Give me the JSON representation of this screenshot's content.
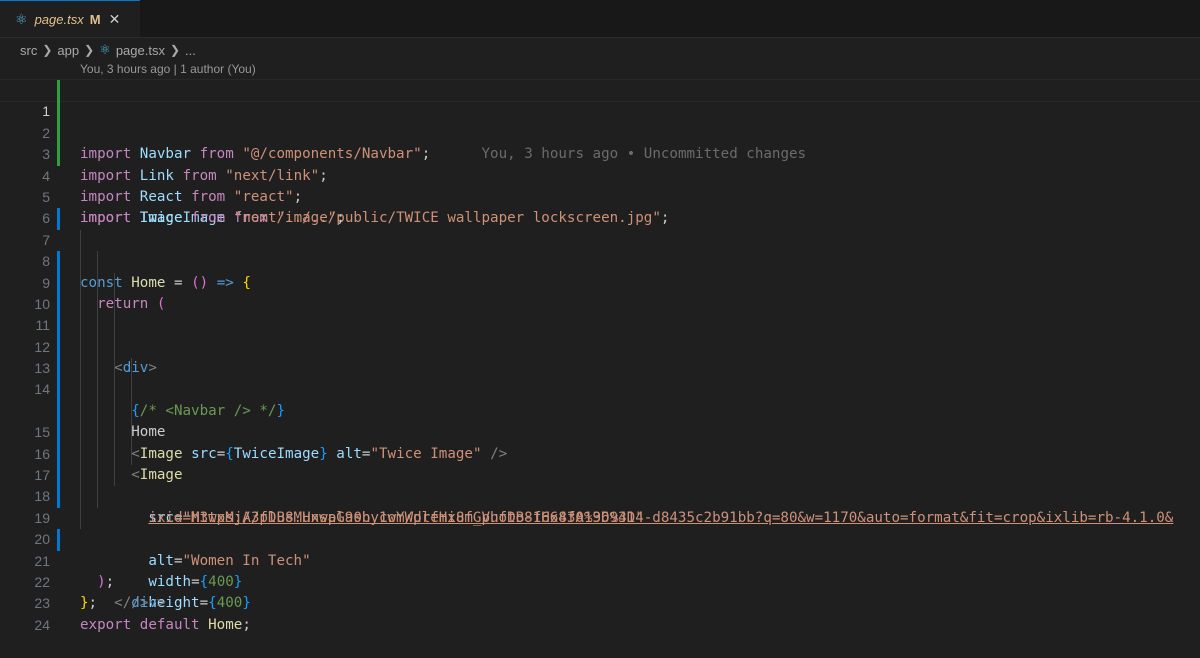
{
  "tab": {
    "filename": "page.tsx",
    "modified": "M",
    "close": "✕"
  },
  "breadcrumb": {
    "src": "src",
    "app": "app",
    "file": "page.tsx",
    "more": "..."
  },
  "codelens": "You, 3 hours ago | 1 author (You)",
  "blame": "You, 3 hours ago • Uncommitted changes",
  "lines": {
    "n1": "1",
    "n2": "2",
    "n3": "3",
    "n4": "4",
    "n5": "5",
    "n6": "6",
    "n7": "7",
    "n8": "8",
    "n9": "9",
    "n10": "10",
    "n11": "11",
    "n12": "12",
    "n13": "13",
    "n14": "14",
    "n15": "15",
    "n16": "16",
    "n17": "17",
    "n18": "18",
    "n19": "19",
    "n20": "20",
    "n21": "21",
    "n22": "22",
    "n23": "23",
    "n24": "24"
  },
  "code": {
    "import": "import",
    "from": "from",
    "const": "const",
    "return": "return",
    "export": "export",
    "default": "default",
    "navbar": "Navbar",
    "navbar_path": "\"@/components/Navbar\"",
    "link": "Link",
    "link_path": "\"next/link\"",
    "react": "React",
    "react_path": "\"react\"",
    "twice": "TwiceImage",
    "twice_path": "\"../../public/TWICE wallpaper lockscreen.jpg\"",
    "image": "Image",
    "image_path": "\"next/image\"",
    "home": "Home",
    "arrow": "=>",
    "div": "div",
    "comment": "/* <Navbar /> */",
    "home_text": "Home",
    "src": "src",
    "alt": "alt",
    "width": "width",
    "height": "height",
    "alt1": "\"Twice Image\"",
    "url_q": "\"",
    "url1": "https://plus.unsplash.com/premium_photo-1664301969414-d8435c2b91bb?q=80&w=1170&auto=format&fit=crop&ixlib=rb-4.1.0&",
    "url2": "ixid=M3wxMjA3fDB8MHxwaG90by1wYWdlfHx8fGVufDB8fHx8fA%3D%3D",
    "alt2": "\"Women In Tech\"",
    "num400": "400"
  }
}
